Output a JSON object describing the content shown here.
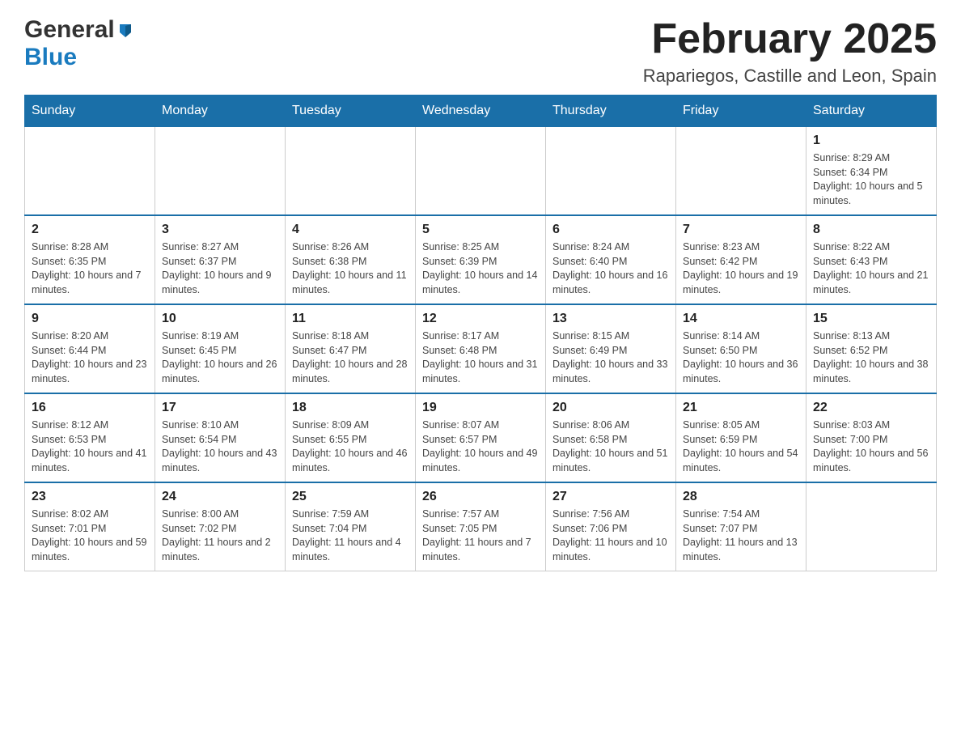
{
  "header": {
    "logo_general": "General",
    "logo_blue": "Blue",
    "month_title": "February 2025",
    "location": "Rapariegos, Castille and Leon, Spain"
  },
  "weekdays": [
    "Sunday",
    "Monday",
    "Tuesday",
    "Wednesday",
    "Thursday",
    "Friday",
    "Saturday"
  ],
  "weeks": [
    [
      {
        "day": "",
        "info": ""
      },
      {
        "day": "",
        "info": ""
      },
      {
        "day": "",
        "info": ""
      },
      {
        "day": "",
        "info": ""
      },
      {
        "day": "",
        "info": ""
      },
      {
        "day": "",
        "info": ""
      },
      {
        "day": "1",
        "info": "Sunrise: 8:29 AM\nSunset: 6:34 PM\nDaylight: 10 hours and 5 minutes."
      }
    ],
    [
      {
        "day": "2",
        "info": "Sunrise: 8:28 AM\nSunset: 6:35 PM\nDaylight: 10 hours and 7 minutes."
      },
      {
        "day": "3",
        "info": "Sunrise: 8:27 AM\nSunset: 6:37 PM\nDaylight: 10 hours and 9 minutes."
      },
      {
        "day": "4",
        "info": "Sunrise: 8:26 AM\nSunset: 6:38 PM\nDaylight: 10 hours and 11 minutes."
      },
      {
        "day": "5",
        "info": "Sunrise: 8:25 AM\nSunset: 6:39 PM\nDaylight: 10 hours and 14 minutes."
      },
      {
        "day": "6",
        "info": "Sunrise: 8:24 AM\nSunset: 6:40 PM\nDaylight: 10 hours and 16 minutes."
      },
      {
        "day": "7",
        "info": "Sunrise: 8:23 AM\nSunset: 6:42 PM\nDaylight: 10 hours and 19 minutes."
      },
      {
        "day": "8",
        "info": "Sunrise: 8:22 AM\nSunset: 6:43 PM\nDaylight: 10 hours and 21 minutes."
      }
    ],
    [
      {
        "day": "9",
        "info": "Sunrise: 8:20 AM\nSunset: 6:44 PM\nDaylight: 10 hours and 23 minutes."
      },
      {
        "day": "10",
        "info": "Sunrise: 8:19 AM\nSunset: 6:45 PM\nDaylight: 10 hours and 26 minutes."
      },
      {
        "day": "11",
        "info": "Sunrise: 8:18 AM\nSunset: 6:47 PM\nDaylight: 10 hours and 28 minutes."
      },
      {
        "day": "12",
        "info": "Sunrise: 8:17 AM\nSunset: 6:48 PM\nDaylight: 10 hours and 31 minutes."
      },
      {
        "day": "13",
        "info": "Sunrise: 8:15 AM\nSunset: 6:49 PM\nDaylight: 10 hours and 33 minutes."
      },
      {
        "day": "14",
        "info": "Sunrise: 8:14 AM\nSunset: 6:50 PM\nDaylight: 10 hours and 36 minutes."
      },
      {
        "day": "15",
        "info": "Sunrise: 8:13 AM\nSunset: 6:52 PM\nDaylight: 10 hours and 38 minutes."
      }
    ],
    [
      {
        "day": "16",
        "info": "Sunrise: 8:12 AM\nSunset: 6:53 PM\nDaylight: 10 hours and 41 minutes."
      },
      {
        "day": "17",
        "info": "Sunrise: 8:10 AM\nSunset: 6:54 PM\nDaylight: 10 hours and 43 minutes."
      },
      {
        "day": "18",
        "info": "Sunrise: 8:09 AM\nSunset: 6:55 PM\nDaylight: 10 hours and 46 minutes."
      },
      {
        "day": "19",
        "info": "Sunrise: 8:07 AM\nSunset: 6:57 PM\nDaylight: 10 hours and 49 minutes."
      },
      {
        "day": "20",
        "info": "Sunrise: 8:06 AM\nSunset: 6:58 PM\nDaylight: 10 hours and 51 minutes."
      },
      {
        "day": "21",
        "info": "Sunrise: 8:05 AM\nSunset: 6:59 PM\nDaylight: 10 hours and 54 minutes."
      },
      {
        "day": "22",
        "info": "Sunrise: 8:03 AM\nSunset: 7:00 PM\nDaylight: 10 hours and 56 minutes."
      }
    ],
    [
      {
        "day": "23",
        "info": "Sunrise: 8:02 AM\nSunset: 7:01 PM\nDaylight: 10 hours and 59 minutes."
      },
      {
        "day": "24",
        "info": "Sunrise: 8:00 AM\nSunset: 7:02 PM\nDaylight: 11 hours and 2 minutes."
      },
      {
        "day": "25",
        "info": "Sunrise: 7:59 AM\nSunset: 7:04 PM\nDaylight: 11 hours and 4 minutes."
      },
      {
        "day": "26",
        "info": "Sunrise: 7:57 AM\nSunset: 7:05 PM\nDaylight: 11 hours and 7 minutes."
      },
      {
        "day": "27",
        "info": "Sunrise: 7:56 AM\nSunset: 7:06 PM\nDaylight: 11 hours and 10 minutes."
      },
      {
        "day": "28",
        "info": "Sunrise: 7:54 AM\nSunset: 7:07 PM\nDaylight: 11 hours and 13 minutes."
      },
      {
        "day": "",
        "info": ""
      }
    ]
  ]
}
